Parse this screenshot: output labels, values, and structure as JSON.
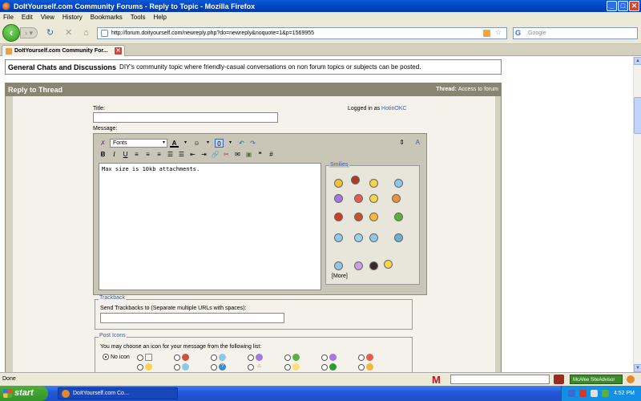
{
  "window": {
    "title": "DoItYourself.com Community Forums - Reply to Topic - Mozilla Firefox",
    "buttons": {
      "minimize": "_",
      "maximize": "□",
      "close": "✕"
    }
  },
  "menu": [
    "File",
    "Edit",
    "View",
    "History",
    "Bookmarks",
    "Tools",
    "Help"
  ],
  "nav": {
    "url": "http://forum.doityourself.com/newreply.php?do=newreply&noquote=1&p=1569955",
    "search_placeholder": "Google"
  },
  "tab": {
    "label": "DoItYourself.com Community For..."
  },
  "page": {
    "topic_title": "General Chats and Discussions",
    "topic_desc": "DIY's community topic where friendly-casual conversations on non forum topics or subjects can be posted.",
    "reply_header": "Reply to Thread",
    "thread_label": "Thread:",
    "thread_value": "Access to forum",
    "title_label": "Title:",
    "message_label": "Message:",
    "logged_in_as": "Logged in as",
    "username": "HotinOKC",
    "fonts_label": "Fonts",
    "message_text": "Max size is 10kb attachments.",
    "smilies_title": "Smilies",
    "more_label": "More",
    "trackback_title": "Trackback",
    "trackback_label": "Send Trackbacks to (Separate multiple URLs with spaces):",
    "post_icons_title": "Post Icons",
    "post_icons_label": "You may choose an icon for your message from the following list:",
    "no_icon": "No icon"
  },
  "status": {
    "text": "Done",
    "advisor": "McAfee SiteAdvisor"
  },
  "taskbar": {
    "start": "start",
    "task": "DoItYourself.com Co...",
    "clock": "4:52 PM"
  }
}
